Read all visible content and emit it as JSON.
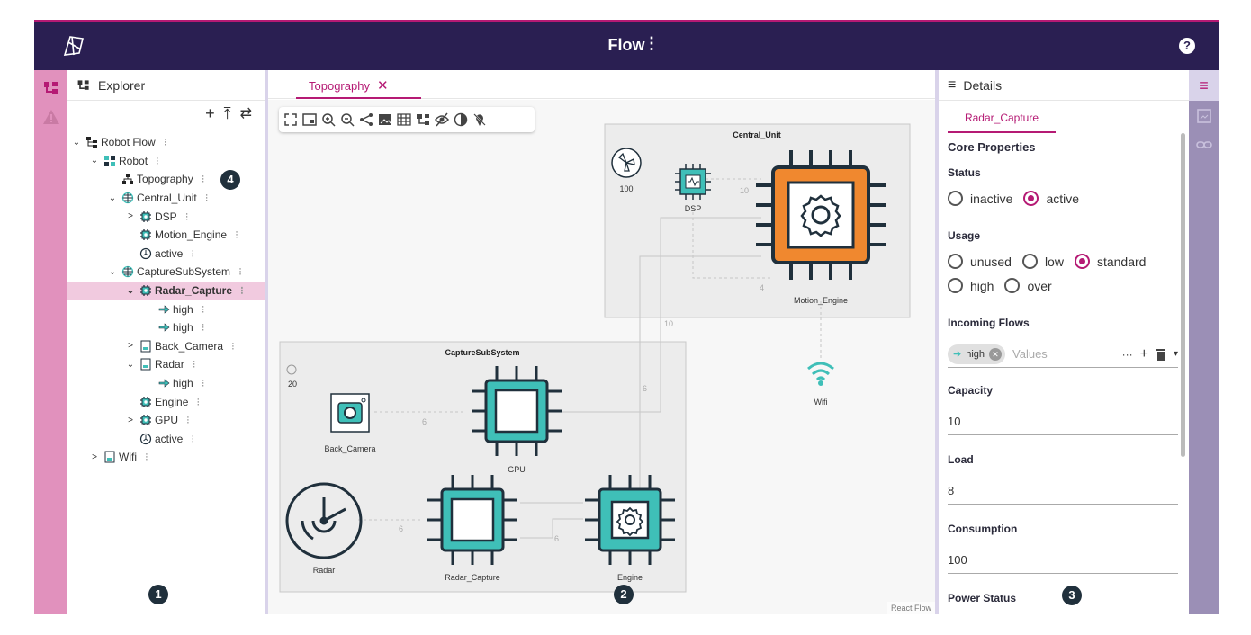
{
  "app": {
    "title": "Flow",
    "menu_glyph": "⋮",
    "help_glyph": "?"
  },
  "colors": {
    "topbar": "#2a1f52",
    "accent": "#b51a74",
    "teal": "#3fbfb8",
    "orange": "#f0882f",
    "left_rail": "#e191bd",
    "right_rail": "#9b8fb6"
  },
  "explorer": {
    "title": "Explorer",
    "tools": [
      "+",
      "⤒",
      "⇄"
    ],
    "tree": [
      {
        "label": "Robot Flow",
        "indent": 0,
        "chevron": "⌄",
        "icon": "flow-icon"
      },
      {
        "label": "Robot",
        "indent": 1,
        "chevron": "⌄",
        "icon": "grid-icon"
      },
      {
        "label": "Topography",
        "indent": 2,
        "chevron": "",
        "icon": "hierarchy-icon"
      },
      {
        "label": "Central_Unit",
        "indent": 2,
        "chevron": "⌄",
        "icon": "globe-icon"
      },
      {
        "label": "DSP",
        "indent": 3,
        "chevron": ">",
        "icon": "chip-icon"
      },
      {
        "label": "Motion_Engine",
        "indent": 3,
        "chevron": "",
        "icon": "chip-icon"
      },
      {
        "label": "active",
        "indent": 3,
        "chevron": "",
        "icon": "power-icon"
      },
      {
        "label": "CaptureSubSystem",
        "indent": 2,
        "chevron": "⌄",
        "icon": "globe-icon"
      },
      {
        "label": "Radar_Capture",
        "indent": 3,
        "chevron": "⌄",
        "icon": "chip-icon",
        "selected": true
      },
      {
        "label": "high",
        "indent": 4,
        "chevron": "",
        "icon": "arrow-icon"
      },
      {
        "label": "high",
        "indent": 4,
        "chevron": "",
        "icon": "arrow-icon"
      },
      {
        "label": "Back_Camera",
        "indent": 3,
        "chevron": ">",
        "icon": "sensor-icon"
      },
      {
        "label": "Radar",
        "indent": 3,
        "chevron": "⌄",
        "icon": "sensor-icon"
      },
      {
        "label": "high",
        "indent": 4,
        "chevron": "",
        "icon": "arrow-icon"
      },
      {
        "label": "Engine",
        "indent": 3,
        "chevron": "",
        "icon": "chip-icon"
      },
      {
        "label": "GPU",
        "indent": 3,
        "chevron": ">",
        "icon": "chip-icon"
      },
      {
        "label": "active",
        "indent": 3,
        "chevron": "",
        "icon": "power-icon"
      },
      {
        "label": "Wifi",
        "indent": 1,
        "chevron": ">",
        "icon": "sensor-icon"
      }
    ],
    "row_menu": "⁝"
  },
  "editor": {
    "tab": "Topography",
    "tab_close": "✕",
    "watermark": "React Flow",
    "toolbar_icons": [
      "fit-view-icon",
      "minimap-icon",
      "zoom-in-icon",
      "zoom-out-icon",
      "share-icon",
      "image-icon",
      "grid-icon",
      "hierarchy-icon",
      "hide-icon",
      "contrast-icon",
      "pin-off-icon"
    ],
    "groups": {
      "central": "Central_Unit",
      "capture": "CaptureSubSystem"
    },
    "nodes": {
      "fan_central_value": "100",
      "fan_capture_value": "20",
      "dsp": "DSP",
      "motion_engine": "Motion_Engine",
      "wifi": "Wifi",
      "back_camera": "Back_Camera",
      "gpu": "GPU",
      "radar": "Radar",
      "radar_capture": "Radar_Capture",
      "engine": "Engine"
    },
    "edge_labels": {
      "dsp_motion": "10",
      "motion_4": "4",
      "gpu_motion": "10",
      "engine_motion": "6",
      "camera_gpu": "6",
      "radar_rc": "6",
      "rc_engine": "6"
    }
  },
  "details": {
    "title": "Details",
    "tab": "Radar_Capture",
    "section": "Core Properties",
    "status": {
      "label": "Status",
      "options": [
        "inactive",
        "active"
      ],
      "selected": "active"
    },
    "usage": {
      "label": "Usage",
      "options": [
        "unused",
        "low",
        "standard",
        "high",
        "over"
      ],
      "selected": "standard"
    },
    "incoming": {
      "label": "Incoming Flows",
      "chip": "high",
      "placeholder": "Values",
      "actions": "···"
    },
    "capacity": {
      "label": "Capacity",
      "value": "10"
    },
    "load": {
      "label": "Load",
      "value": "8"
    },
    "consumption": {
      "label": "Consumption",
      "value": "100"
    },
    "power_status": {
      "label": "Power Status"
    }
  },
  "badges": {
    "explorer": "1",
    "canvas": "2",
    "details": "3",
    "tree_item": "4"
  }
}
